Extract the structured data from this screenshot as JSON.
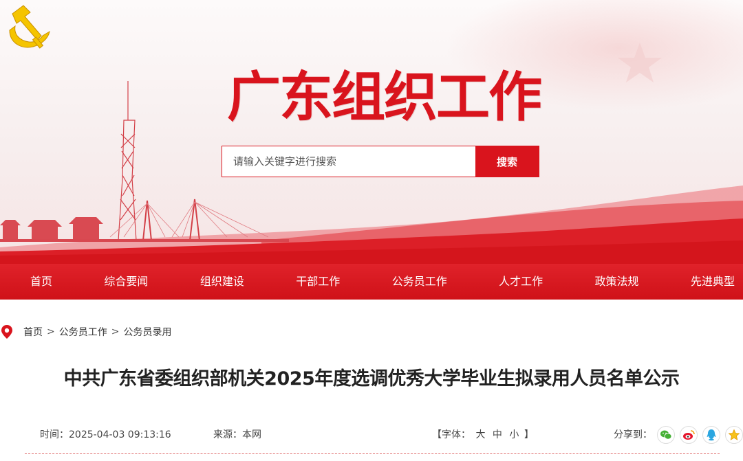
{
  "header": {
    "site_title": "广东组织工作",
    "search": {
      "placeholder": "请输入关键字进行搜索",
      "button_label": "搜索"
    }
  },
  "nav": {
    "items": [
      "首页",
      "综合要闻",
      "组织建设",
      "干部工作",
      "公务员工作",
      "人才工作",
      "政策法规",
      "先进典型"
    ]
  },
  "breadcrumb": {
    "items": [
      "首页",
      "公务员工作",
      "公务员录用"
    ],
    "separator": ">"
  },
  "article": {
    "title": "中共广东省委组织部机关2025年度选调优秀大学毕业生拟录用人员名单公示",
    "time_label": "时间：",
    "time": "2025-04-03 09:13:16",
    "source_label": "来源：",
    "source": "本网",
    "font_label_open": "【字体：",
    "font_sizes": [
      "大",
      "中",
      "小"
    ],
    "font_label_close": "】",
    "share_label": "分享到："
  },
  "colors": {
    "brand_red": "#d9141d",
    "emblem_gold": "#f5c400"
  },
  "icons": {
    "location": "location-pin-icon",
    "share": [
      "wechat-icon",
      "weibo-icon",
      "qq-icon",
      "qzone-icon"
    ]
  }
}
